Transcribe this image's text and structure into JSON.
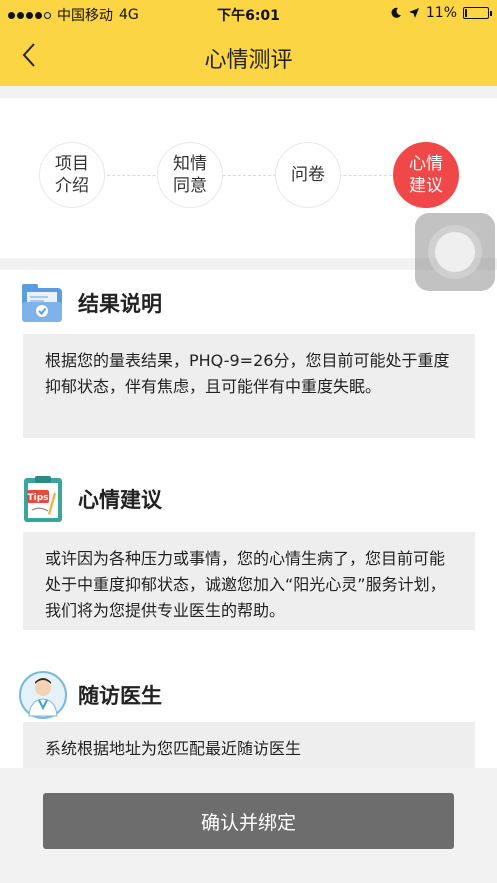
{
  "status_bar": {
    "carrier": "中国移动",
    "network": "4G",
    "time": "下午6:01",
    "battery": "11%",
    "battery_level": 0.11
  },
  "nav": {
    "back_icon": "chevron-left-icon",
    "title": "心情测评"
  },
  "steps": [
    {
      "label": "项目\n介绍",
      "active": false
    },
    {
      "label": "知情\n同意",
      "active": false
    },
    {
      "label": "问卷",
      "active": false
    },
    {
      "label": "心情\n建议",
      "active": true
    }
  ],
  "sections": {
    "result": {
      "icon": "folder-check-icon",
      "title": "结果说明",
      "body": "根据您的量表结果，PHQ-9=26分，您目前可能处于重度抑郁状态，伴有焦虑，且可能伴有中重度失眠。"
    },
    "advice": {
      "icon": "tips-clipboard-icon",
      "icon_text": "Tips",
      "title": "心情建议",
      "body": "或许因为各种压力或事情，您的心情生病了，您目前可能处于中重度抑郁状态，诚邀您加入“阳光心灵”服务计划，我们将为您提供专业医生的帮助。"
    },
    "doctor": {
      "icon": "doctor-avatar-icon",
      "title": "随访医生",
      "body": "系统根据地址为您匹配最近随访医生"
    }
  },
  "footer": {
    "confirm_label": "确认并绑定"
  },
  "colors": {
    "header_bg": "#fcd545",
    "active_step": "#f04848",
    "button_bg": "#6d6d6d"
  }
}
